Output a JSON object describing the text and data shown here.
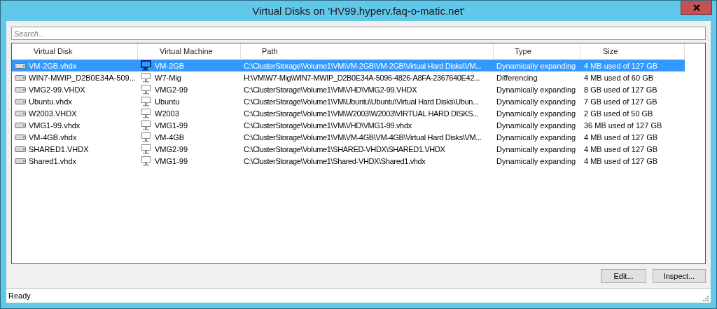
{
  "window": {
    "title": "Virtual Disks on 'HV99.hyperv.faq-o-matic.net'"
  },
  "search": {
    "placeholder": "Search..."
  },
  "table": {
    "columns": [
      "Virtual Disk",
      "Virtual Machine",
      "Path",
      "Type",
      "Size"
    ],
    "rows": [
      {
        "selected": true,
        "vm_running": true,
        "cells": [
          "VM-2GB.vhdx",
          "VM-2GB",
          "C:\\ClusterStorage\\Volume1\\VM\\VM-2GB\\VM-2GB\\Virtual Hard Disks\\VM...",
          "Dynamically expanding",
          "4 MB used of 127 GB"
        ]
      },
      {
        "selected": false,
        "vm_running": false,
        "cells": [
          "WIN7-MWIP_D2B0E34A-509...",
          "W7-Mig",
          "H:\\VM\\W7-Mig\\WIN7-MWIP_D2B0E34A-5096-4826-A8FA-2367640E42...",
          "Differencing",
          "4 MB used of 60 GB"
        ]
      },
      {
        "selected": false,
        "vm_running": false,
        "cells": [
          "VMG2-99.VHDX",
          "VMG2-99",
          "C:\\ClusterStorage\\Volume1\\VM\\VHD\\VMG2-99.VHDX",
          "Dynamically expanding",
          "8 GB used of 127 GB"
        ]
      },
      {
        "selected": false,
        "vm_running": false,
        "cells": [
          "Ubuntu.vhdx",
          "Ubuntu",
          "C:\\ClusterStorage\\Volume1\\VM\\Ubuntu\\Ubuntu\\Virtual Hard Disks\\Ubun...",
          "Dynamically expanding",
          "7 GB used of 127 GB"
        ]
      },
      {
        "selected": false,
        "vm_running": false,
        "cells": [
          "W2003.VHDX",
          "W2003",
          "C:\\ClusterStorage\\Volume1\\VM\\W2003\\W2003\\VIRTUAL HARD DISKS...",
          "Dynamically expanding",
          "2 GB used of 50 GB"
        ]
      },
      {
        "selected": false,
        "vm_running": false,
        "cells": [
          "VMG1-99.vhdx",
          "VMG1-99",
          "C:\\ClusterStorage\\Volume1\\VM\\VHD\\VMG1-99.vhdx",
          "Dynamically expanding",
          "36 MB used of 127 GB"
        ]
      },
      {
        "selected": false,
        "vm_running": false,
        "cells": [
          "VM-4GB.vhdx",
          "VM-4GB",
          "C:\\ClusterStorage\\Volume1\\VM\\VM-4GB\\VM-4GB\\Virtual Hard Disks\\VM...",
          "Dynamically expanding",
          "4 MB used of 127 GB"
        ]
      },
      {
        "selected": false,
        "vm_running": false,
        "cells": [
          "SHARED1.VHDX",
          "VMG2-99",
          "C:\\ClusterStorage\\Volume1\\SHARED-VHDX\\SHARED1.VHDX",
          "Dynamically expanding",
          "4 MB used of 127 GB"
        ]
      },
      {
        "selected": false,
        "vm_running": false,
        "cells": [
          "Shared1.vhdx",
          "VMG1-99",
          "C:\\ClusterStorage\\Volume1\\Shared-VHDX\\Shared1.vhdx",
          "Dynamically expanding",
          "4 MB used of 127 GB"
        ]
      }
    ]
  },
  "buttons": [
    "Edit...",
    "Inspect..."
  ],
  "status_bar": {
    "text": "Ready"
  }
}
